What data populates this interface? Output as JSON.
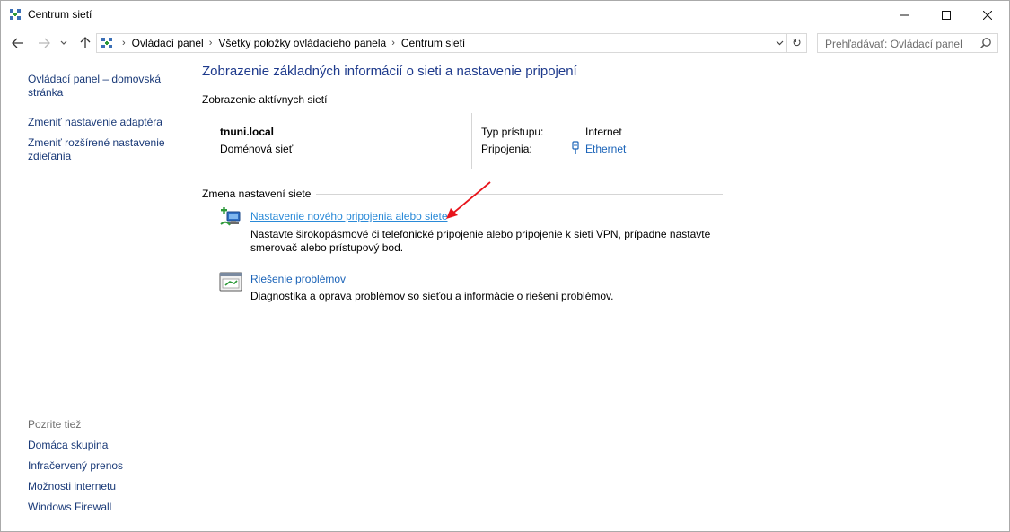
{
  "window": {
    "title": "Centrum sietí"
  },
  "nav": {
    "breadcrumbs": [
      "Ovládací panel",
      "Všetky položky ovládacieho panela",
      "Centrum sietí"
    ],
    "search_placeholder": "Prehľadávať: Ovládací panel"
  },
  "sidebar": {
    "links": [
      "Ovládací panel – domovská stránka",
      "Zmeniť nastavenie adaptéra",
      "Zmeniť rozšírené nastavenie zdieľania"
    ],
    "see_also_title": "Pozrite tiež",
    "see_also": [
      "Domáca skupina",
      "Infračervený prenos",
      "Možnosti internetu",
      "Windows Firewall"
    ]
  },
  "main": {
    "title": "Zobrazenie základných informácií o sieti a nastavenie pripojení",
    "active_networks_heading": "Zobrazenie aktívnych sietí",
    "network": {
      "name": "tnuni.local",
      "type": "Doménová sieť",
      "access_type_label": "Typ prístupu:",
      "access_type_value": "Internet",
      "connections_label": "Pripojenia:",
      "connection_value": "Ethernet"
    },
    "change_heading": "Zmena nastavení siete",
    "tasks": [
      {
        "label": "Nastavenie nového pripojenia alebo siete",
        "desc_line1": "Nastavte širokopásmové či telefonické pripojenie alebo pripojenie k sieti VPN, prípadne nastavte",
        "desc_line2": "smerovač alebo prístupový bod."
      },
      {
        "label": "Riešenie problémov",
        "desc_line1": "Diagnostika a oprava problémov so sieťou a informácie o riešení problémov.",
        "desc_line2": ""
      }
    ]
  },
  "colors": {
    "link": "#1a63b8",
    "hover_link": "#2a8ad8",
    "title_blue": "#1e3a8c",
    "annotation_red": "#e8141b"
  }
}
